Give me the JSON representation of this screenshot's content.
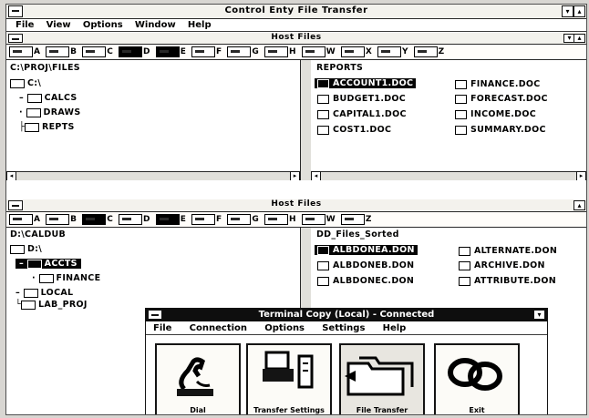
{
  "app": {
    "title": "Control Enty File Transfer",
    "menu": [
      "File",
      "View",
      "Options",
      "Window",
      "Help"
    ]
  },
  "upper_window": {
    "title": "Host Files",
    "drives": [
      "A",
      "B",
      "C",
      "D",
      "E",
      "F",
      "G",
      "H",
      "W",
      "X",
      "Y",
      "Z"
    ],
    "selected_drive": "D",
    "path": "C:\\PROJ\\FILES",
    "tree": [
      "C:\\",
      "CALCS",
      "DRAWS",
      "REPTS"
    ],
    "list_header": "REPORTS",
    "files": [
      "ACCOUNT1.DOC",
      "BUDGET1.DOC",
      "CAPITAL1.DOC",
      "COST1.DOC",
      "FINANCE.DOC",
      "FORECAST.DOC",
      "INCOME.DOC",
      "SUMMARY.DOC"
    ]
  },
  "lower_window": {
    "title": "Host Files",
    "drives": [
      "A",
      "B",
      "C",
      "D",
      "E",
      "F",
      "G",
      "H",
      "W",
      "Z"
    ],
    "path": "D:\\CALDUB",
    "tree": [
      "D:\\",
      "ACCTS",
      "FINANCE",
      "LOCAL",
      "LAB_PROJ"
    ],
    "list_header": "DD_Files_Sorted",
    "files": [
      "ALBDONEA.DON",
      "ALBDONEB.DON",
      "ALBDONEC.DON",
      "ALTERNATE.DON",
      "ARCHIVE.DON",
      "ATTRIBUTE.DON"
    ]
  },
  "terminal": {
    "title": "Terminal Copy (Local) - Connected",
    "menu": [
      "File",
      "Connection",
      "Options",
      "Settings",
      "Help"
    ],
    "buttons": [
      "Dial",
      "Transfer Settings",
      "File Transfer",
      "Exit"
    ]
  }
}
